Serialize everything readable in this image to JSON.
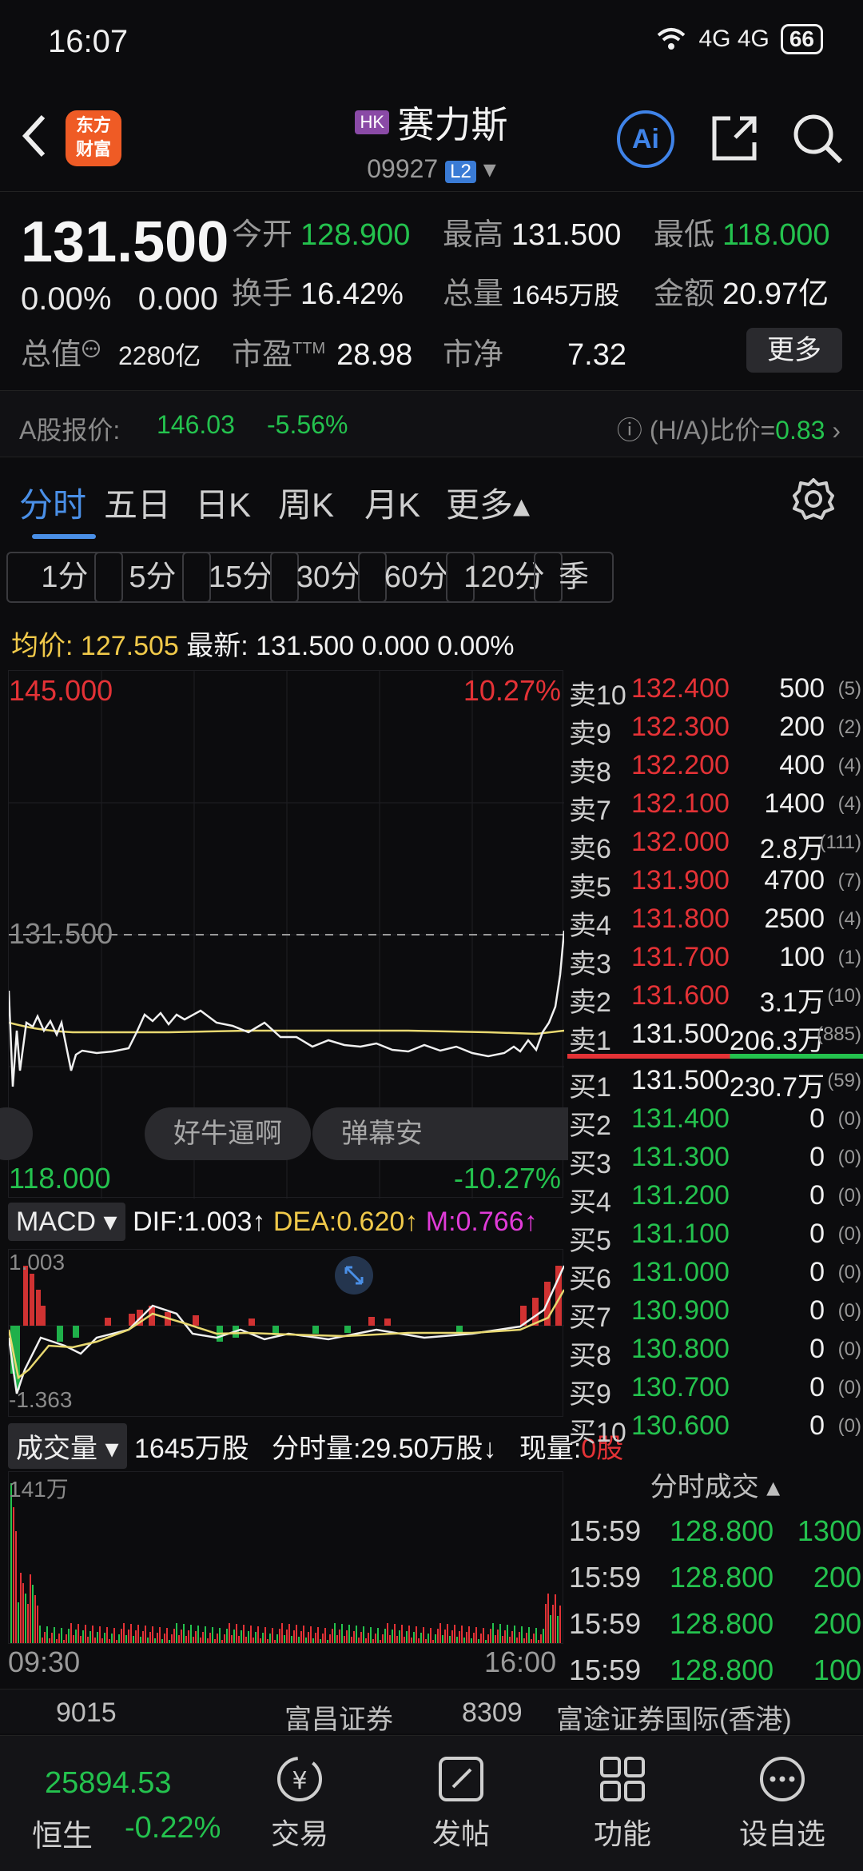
{
  "status_bar": {
    "time": "16:07",
    "network": "4G 4G",
    "battery": "66"
  },
  "header": {
    "back_icon": "back-chevron-icon",
    "logo_line1": "东方",
    "logo_line2": "财富",
    "market_tag": "HK",
    "title": "赛力斯",
    "code": "09927",
    "level_tag": "L2",
    "ai_label": "Ai"
  },
  "quote": {
    "price": "131.500",
    "change_pct": "0.00%",
    "change_abs": "0.000",
    "open_label": "今开",
    "open": "128.900",
    "high_label": "最高",
    "high": "131.500",
    "low_label": "最低",
    "low": "118.000",
    "turnover_label": "换手",
    "turnover": "16.42%",
    "volume_label": "总量",
    "volume": "1645万股",
    "amount_label": "金额",
    "amount": "20.97亿",
    "mcap_label": "总值",
    "mcap": "2280亿",
    "pe_label": "市盈",
    "pe_sup": "TTM",
    "pe": "28.98",
    "pb_label": "市净",
    "pb": "7.32",
    "more_label": "更多"
  },
  "ashare": {
    "label": "A股报价:",
    "price": "146.03",
    "pct": "-5.56%",
    "ratio_label": "(H/A)比价=",
    "ratio": "0.83"
  },
  "period_tabs": [
    {
      "label": "分时",
      "active": true
    },
    {
      "label": "五日"
    },
    {
      "label": "日K"
    },
    {
      "label": "周K"
    },
    {
      "label": "月K"
    },
    {
      "label": "更多▴"
    }
  ],
  "minute_buttons": [
    "1分",
    "5分",
    "15分",
    "30分",
    "60分",
    "120分",
    "季"
  ],
  "avg_line": {
    "avg_label": "均价:",
    "avg": "127.505",
    "latest_label": "最新:",
    "latest": "131.500",
    "chg": "0.000",
    "pct": "0.00%"
  },
  "chart": {
    "y_max": "145.000",
    "y_min": "118.000",
    "pct_max": "10.27%",
    "pct_min": "-10.27%",
    "ref_price": "131.500",
    "bubble1": "好牛逼啊",
    "bubble2": "弹幕安"
  },
  "macd": {
    "tag": "MACD ▾",
    "dif": "DIF:1.003↑",
    "dea": "DEA:0.620↑",
    "m": "M:0.766↑",
    "top": "1.003",
    "bottom": "-1.363"
  },
  "volume": {
    "tag": "成交量 ▾",
    "total": "1645万股",
    "minute_vol": "分时量:29.50万股↓",
    "now_label": "现量:",
    "now": "0股",
    "top": "141万"
  },
  "time_axis": {
    "start": "09:30",
    "end": "16:00"
  },
  "order_book": {
    "asks": [
      {
        "level": "卖10",
        "price": "132.400",
        "qty": "500",
        "count": "(5)"
      },
      {
        "level": "卖9",
        "price": "132.300",
        "qty": "200",
        "count": "(2)"
      },
      {
        "level": "卖8",
        "price": "132.200",
        "qty": "400",
        "count": "(4)"
      },
      {
        "level": "卖7",
        "price": "132.100",
        "qty": "1400",
        "count": "(4)"
      },
      {
        "level": "卖6",
        "price": "132.000",
        "qty": "2.8万",
        "count": "(111)"
      },
      {
        "level": "卖5",
        "price": "131.900",
        "qty": "4700",
        "count": "(7)"
      },
      {
        "level": "卖4",
        "price": "131.800",
        "qty": "2500",
        "count": "(4)"
      },
      {
        "level": "卖3",
        "price": "131.700",
        "qty": "100",
        "count": "(1)"
      },
      {
        "level": "卖2",
        "price": "131.600",
        "qty": "3.1万",
        "count": "(10)"
      },
      {
        "level": "卖1",
        "price": "131.500",
        "qty": "206.3万",
        "count": "(885)"
      }
    ],
    "bids": [
      {
        "level": "买1",
        "price": "131.500",
        "qty": "230.7万",
        "count": "(59)"
      },
      {
        "level": "买2",
        "price": "131.400",
        "qty": "0",
        "count": "(0)"
      },
      {
        "level": "买3",
        "price": "131.300",
        "qty": "0",
        "count": "(0)"
      },
      {
        "level": "买4",
        "price": "131.200",
        "qty": "0",
        "count": "(0)"
      },
      {
        "level": "买5",
        "price": "131.100",
        "qty": "0",
        "count": "(0)"
      },
      {
        "level": "买6",
        "price": "131.000",
        "qty": "0",
        "count": "(0)"
      },
      {
        "level": "买7",
        "price": "130.900",
        "qty": "0",
        "count": "(0)"
      },
      {
        "level": "买8",
        "price": "130.800",
        "qty": "0",
        "count": "(0)"
      },
      {
        "level": "买9",
        "price": "130.700",
        "qty": "0",
        "count": "(0)"
      },
      {
        "level": "买10",
        "price": "130.600",
        "qty": "0",
        "count": "(0)"
      }
    ]
  },
  "ticks": {
    "title": "分时成交 ▴",
    "rows": [
      {
        "time": "15:59",
        "price": "128.800",
        "vol": "1300"
      },
      {
        "time": "15:59",
        "price": "128.800",
        "vol": "200"
      },
      {
        "time": "15:59",
        "price": "128.800",
        "vol": "200"
      },
      {
        "time": "15:59",
        "price": "128.800",
        "vol": "100"
      }
    ]
  },
  "brokers": {
    "id1": "9015",
    "name1": "富昌证券",
    "id2": "8309",
    "name2": "富途证券国际(香港)"
  },
  "bottom_nav": {
    "index_value": "25894.53",
    "index_name": "恒生",
    "index_chg": "-0.22%",
    "items": [
      "交易",
      "发帖",
      "功能",
      "设自选"
    ]
  },
  "colors": {
    "up": "#e43236",
    "down": "#24c24e",
    "accent": "#4a8fe6",
    "avg_line": "#e8d870"
  }
}
